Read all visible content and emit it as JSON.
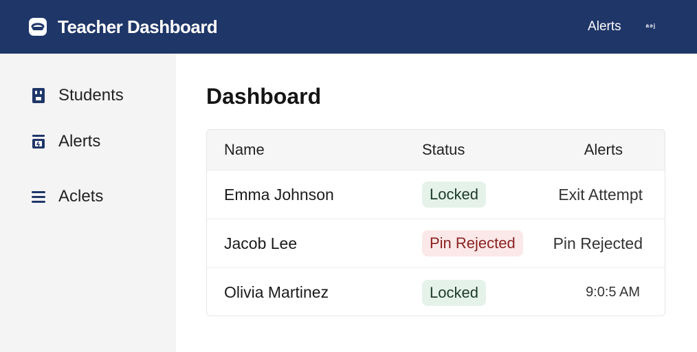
{
  "header": {
    "title": "Teacher Dashboard",
    "alerts_link": "Alerts",
    "user_menu": "ᵃᵊʲ",
    "bg_color": "#1f3668"
  },
  "sidebar": {
    "items": [
      {
        "label": "Students",
        "icon": "student-icon"
      },
      {
        "label": "Alerts",
        "icon": "alert-icon"
      },
      {
        "label": "Aclets",
        "icon": "list-icon"
      }
    ]
  },
  "main": {
    "title": "Dashboard",
    "table": {
      "columns": [
        "Name",
        "Status",
        "Alerts"
      ],
      "rows": [
        {
          "name": "Emma Johnson",
          "status": "Locked",
          "status_kind": "locked",
          "alert": "Exit Attempt"
        },
        {
          "name": "Jacob Lee",
          "status": "Pin Rejected",
          "status_kind": "rejected",
          "alert": "Pin Rejected"
        },
        {
          "name": "Olivia Martinez",
          "status": "Locked",
          "status_kind": "locked",
          "alert": "9:0:5 AM"
        }
      ]
    }
  },
  "colors": {
    "locked_bg": "#e5f2ea",
    "rejected_bg": "#fbe8e8",
    "rejected_text": "#8a1f1f"
  }
}
